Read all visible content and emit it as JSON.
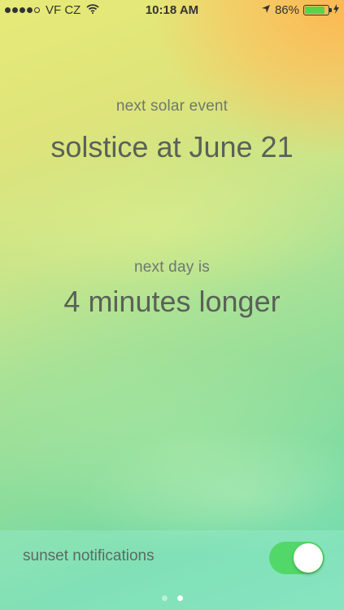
{
  "status_bar": {
    "signal_icon": "signal-dots-icon",
    "carrier": "VF CZ",
    "wifi_icon": "wifi-icon",
    "time": "10:18 AM",
    "location_icon": "location-arrow-icon",
    "battery_percent": "86%",
    "battery_level": 0.86,
    "battery_icon": "battery-icon",
    "charging_icon": "bolt-icon"
  },
  "solar": {
    "label": "next solar event",
    "value": "solstice at June 21"
  },
  "day": {
    "label": "next day is",
    "value": "4 minutes longer"
  },
  "settings": {
    "sunset_label": "sunset notifications",
    "sunset_enabled": true
  },
  "pager": {
    "pages": 2,
    "current": 2
  },
  "colors": {
    "toggle_on": "#52d869",
    "text_primary": "#5a6157",
    "text_secondary": "#6f7770",
    "battery_fill": "#5ad34c"
  }
}
